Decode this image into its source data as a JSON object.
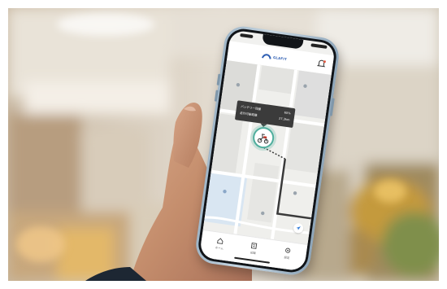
{
  "scene": {
    "description_colors": {
      "accent": "#4fae9d",
      "brand": "#2f5fb3",
      "popup_bg": "#3b3b3b",
      "tab_active": "#555555"
    }
  },
  "app": {
    "logo_text": "GLAFIT",
    "header_action_icon": "bell-icon"
  },
  "map": {
    "popup": {
      "row1_label": "バッテリー残量",
      "row1_value": "65%",
      "row2_label": "走行可能距離",
      "row2_value": "27.3km"
    },
    "marker_icon": "scooter-icon",
    "locate_icon": "locate-arrow-icon"
  },
  "tab_bar": {
    "tabs": [
      {
        "label": "ホーム",
        "icon": "home-icon"
      },
      {
        "label": "記録",
        "icon": "record-icon"
      },
      {
        "label": "設定",
        "icon": "gear-icon"
      }
    ]
  }
}
